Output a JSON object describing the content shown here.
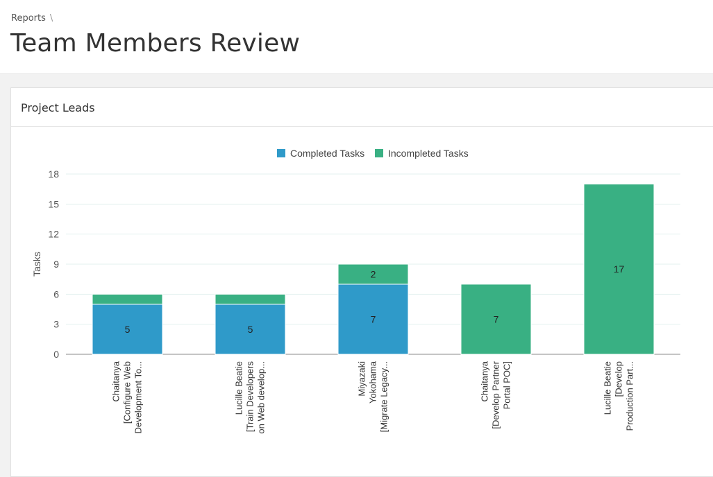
{
  "breadcrumb": {
    "root": "Reports",
    "separator": "\\"
  },
  "page": {
    "title": "Team Members Review"
  },
  "card": {
    "title": "Project Leads"
  },
  "colors": {
    "completed": "#2f9ac9",
    "incompleted": "#39b083"
  },
  "chart_data": {
    "type": "bar",
    "stacked": true,
    "ylabel": "Tasks",
    "ylim": [
      0,
      18
    ],
    "yticks": [
      0,
      3,
      6,
      9,
      12,
      15,
      18
    ],
    "grid": true,
    "legend_position": "top",
    "categories": [
      [
        "Chaitanya",
        "[Configure Web",
        "Development To..."
      ],
      [
        "Lucille Beatie",
        "[Train Developers",
        "on Web develop..."
      ],
      [
        "Miyazaki",
        "Yokohama",
        "[Migrate Legacy..."
      ],
      [
        "Chaitanya",
        "[Develop Partner",
        "Portal POC]"
      ],
      [
        "Lucille Beatie",
        "[Develop",
        "Production Part..."
      ]
    ],
    "series": [
      {
        "name": "Completed Tasks",
        "values": [
          5,
          5,
          7,
          0,
          0
        ]
      },
      {
        "name": "Incompleted Tasks",
        "values": [
          1,
          1,
          2,
          7,
          17
        ]
      }
    ],
    "data_labels": {
      "Completed Tasks": [
        "5",
        "5",
        "7",
        "",
        ""
      ],
      "Incompleted Tasks": [
        "",
        "",
        "2",
        "7",
        "17"
      ]
    }
  }
}
